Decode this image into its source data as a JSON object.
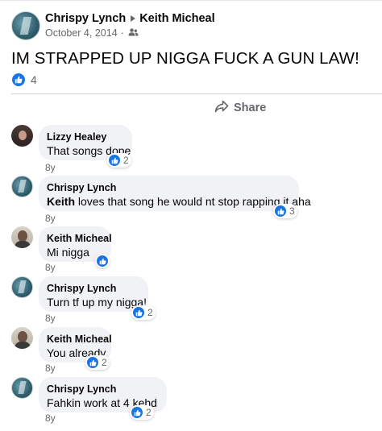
{
  "post": {
    "author": "Chrispy Lynch",
    "recipient": "Keith Micheal",
    "date": "October 4, 2014",
    "separator": "·",
    "privacy_icon": "friends-icon",
    "text": "IM STRAPPED UP NIGGA FUCK A GUN LAW!",
    "reaction_icon": "like-icon",
    "reaction_count": "4",
    "share_label": "Share"
  },
  "colors": {
    "like_blue": "#1b74e4",
    "bubble_bg": "#f0f2f5",
    "secondary_text": "#65676b"
  },
  "comments": [
    {
      "author": "Lizzy Healey",
      "text": "That songs dope",
      "age": "8y",
      "likes": "2"
    },
    {
      "author": "Chrispy Lynch",
      "mention": "Keith",
      "text": " loves that song he would nt stop rapping it aha",
      "age": "8y",
      "likes": "3"
    },
    {
      "author": "Keith Micheal",
      "text": "Mi nigga",
      "age": "8y",
      "likes": ""
    },
    {
      "author": "Chrispy Lynch",
      "text": "Turn tf up my nigga!",
      "age": "8y",
      "likes": "2"
    },
    {
      "author": "Keith Micheal",
      "text": "You already",
      "age": "8y",
      "likes": "2"
    },
    {
      "author": "Chrispy Lynch",
      "text": "Fahkin work at 4 kehd",
      "age": "8y",
      "likes": "2"
    }
  ]
}
